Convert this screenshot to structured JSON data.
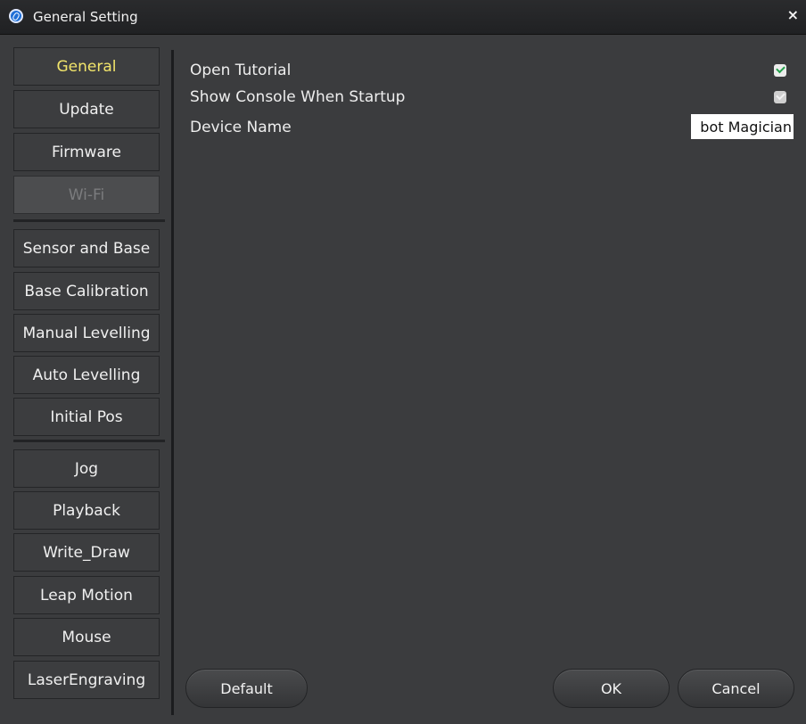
{
  "window": {
    "title": "General Setting",
    "close_glyph": "×"
  },
  "icons": {
    "app": "app-logo-icon",
    "close": "close-icon",
    "checkbox_checked": "checkmark-icon"
  },
  "sidebar": {
    "groups": [
      [
        "General",
        "Update",
        "Firmware",
        "Wi-Fi"
      ],
      [
        "Sensor and Base",
        "Base Calibration",
        "Manual Levelling",
        "Auto Levelling",
        "Initial Pos"
      ],
      [
        "Jog",
        "Playback",
        "Write_Draw",
        "Leap Motion",
        "Mouse",
        "LaserEngraving"
      ]
    ],
    "selected": "General",
    "disabled": [
      "Wi-Fi"
    ]
  },
  "settings": {
    "open_tutorial": {
      "label": "Open Tutorial",
      "checked": true
    },
    "show_console": {
      "label": "Show Console When Startup",
      "checked": false
    },
    "device_name": {
      "label": "Device Name",
      "value": "bot Magician"
    }
  },
  "buttons": {
    "default": "Default",
    "ok": "OK",
    "cancel": "Cancel"
  },
  "colors": {
    "selected_text": "#f2e56b",
    "check_green": "#22a04a",
    "background": "#3b3c3e"
  }
}
